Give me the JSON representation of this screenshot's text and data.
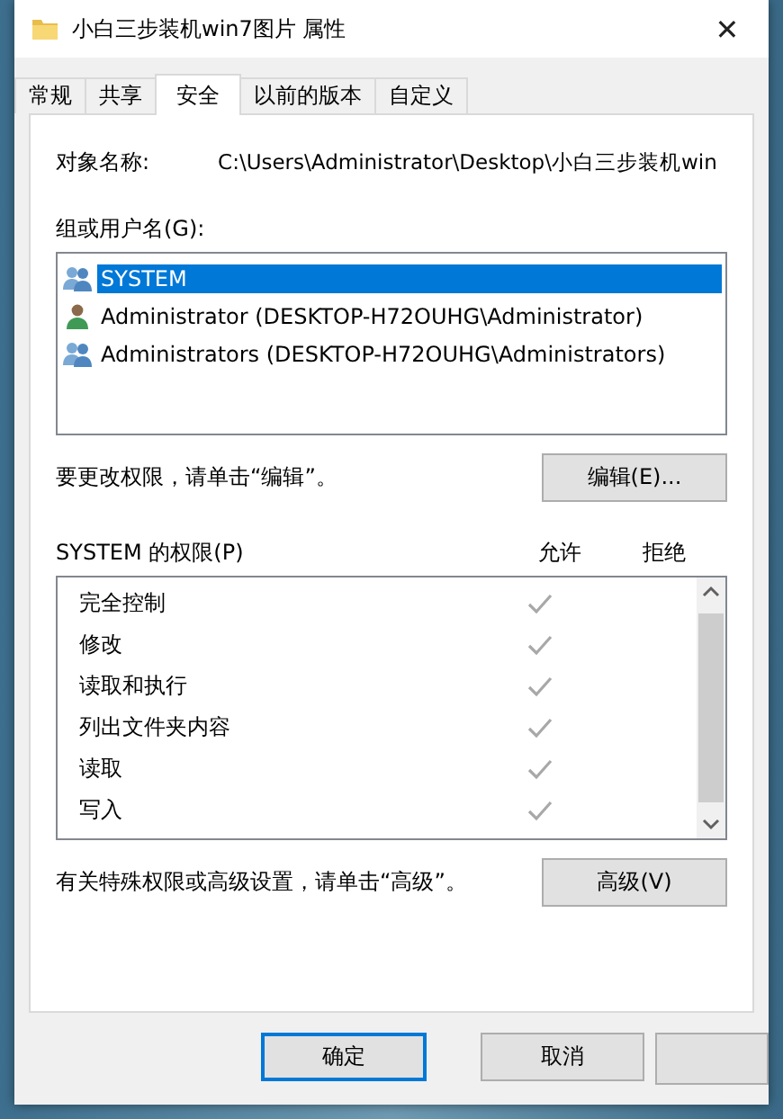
{
  "window": {
    "title": "小白三步装机win7图片 属性",
    "close": "✕"
  },
  "tabs": [
    {
      "label": "常规",
      "selected": false
    },
    {
      "label": "共享",
      "selected": false
    },
    {
      "label": "安全",
      "selected": true
    },
    {
      "label": "以前的版本",
      "selected": false
    },
    {
      "label": "自定义",
      "selected": false
    }
  ],
  "object_name": {
    "label": "对象名称:",
    "value": "C:\\Users\\Administrator\\Desktop\\小白三步装机win"
  },
  "users": {
    "label": "组或用户名(G):",
    "items": [
      {
        "name": "SYSTEM",
        "kind": "group",
        "selected": true
      },
      {
        "name": "Administrator (DESKTOP-H72OUHG\\Administrator)",
        "kind": "user",
        "selected": false
      },
      {
        "name": "Administrators (DESKTOP-H72OUHG\\Administrators)",
        "kind": "group",
        "selected": false
      }
    ]
  },
  "edit_hint": "要更改权限，请单击“编辑”。",
  "edit_button": "编辑(E)...",
  "permissions": {
    "label": "SYSTEM 的权限(P)",
    "allow_header": "允许",
    "deny_header": "拒绝",
    "rows": [
      {
        "name": "完全控制",
        "allow": true,
        "deny": false
      },
      {
        "name": "修改",
        "allow": true,
        "deny": false
      },
      {
        "name": "读取和执行",
        "allow": true,
        "deny": false
      },
      {
        "name": "列出文件夹内容",
        "allow": true,
        "deny": false
      },
      {
        "name": "读取",
        "allow": true,
        "deny": false
      },
      {
        "name": "写入",
        "allow": true,
        "deny": false
      }
    ]
  },
  "advanced_hint": "有关特殊权限或高级设置，请单击“高级”。",
  "advanced_button": "高级(V)",
  "buttons": [
    {
      "label": "确定",
      "default": true
    },
    {
      "label": "取消",
      "default": false
    }
  ]
}
